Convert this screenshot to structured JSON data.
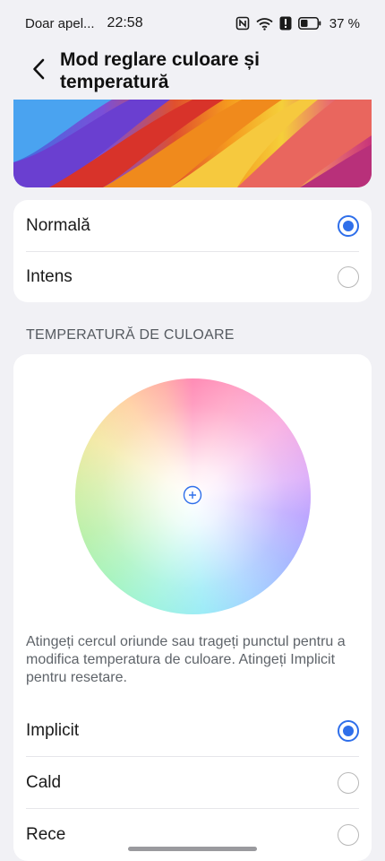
{
  "status_bar": {
    "carrier": "Doar apel...",
    "time": "22:58",
    "battery_percent": "37 %",
    "icons": [
      "nfc-icon",
      "wifi-icon",
      "alert-icon",
      "battery-icon"
    ]
  },
  "header": {
    "title": "Mod reglare culoare și temperatură",
    "back_icon": "chevron-left-icon"
  },
  "color_mode": {
    "options": [
      {
        "label": "Normală",
        "selected": true
      },
      {
        "label": "Intens",
        "selected": false
      }
    ]
  },
  "temperature": {
    "section_title": "TEMPERATURĂ DE CULOARE",
    "help_text": "Atingeți cercul oriunde sau trageți punctul pentru a modifica temperatura de culoare. Atingeți Implicit pentru resetare.",
    "options": [
      {
        "label": "Implicit",
        "selected": true
      },
      {
        "label": "Cald",
        "selected": false
      },
      {
        "label": "Rece",
        "selected": false
      }
    ]
  },
  "colors": {
    "accent": "#2f6fea",
    "background": "#f1f1f5",
    "card": "#ffffff"
  }
}
